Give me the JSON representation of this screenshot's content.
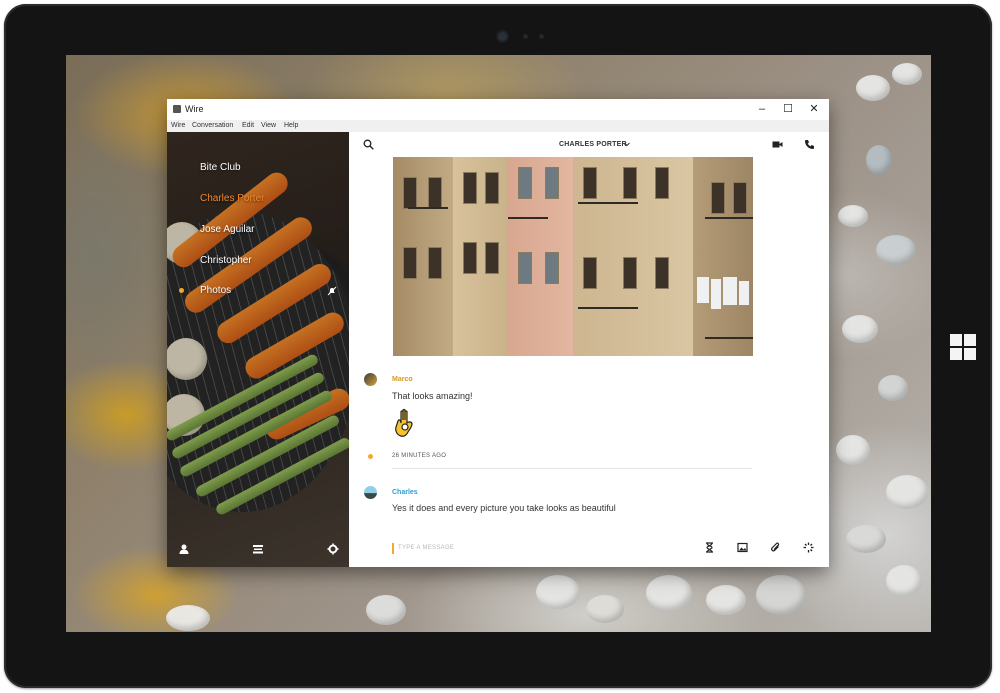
{
  "window": {
    "title": "Wire",
    "minimize": "–",
    "maximize": "☐",
    "close": "✕"
  },
  "menu": [
    "Wire",
    "Conversation",
    "Edit",
    "View",
    "Help"
  ],
  "sidebar": {
    "conversations": [
      {
        "name": "Bite Club",
        "active": false,
        "unread": false,
        "muted": false
      },
      {
        "name": "Charles Porter",
        "active": true,
        "unread": false,
        "muted": false
      },
      {
        "name": "Jose Aguilar",
        "active": false,
        "unread": false,
        "muted": false
      },
      {
        "name": "Christopher",
        "active": false,
        "unread": false,
        "muted": false
      },
      {
        "name": "Photos",
        "active": false,
        "unread": true,
        "muted": true
      }
    ],
    "footer_icons": [
      "profile-icon",
      "archive-icon",
      "settings-icon"
    ]
  },
  "conversation": {
    "title": "CHARLES PORTER",
    "header_icons": [
      "search-icon",
      "video-call-icon",
      "phone-icon"
    ]
  },
  "messages": [
    {
      "author": "Marco",
      "author_color": "#d89b12",
      "text": "That looks amazing!",
      "emoji": "ok-hand-emoji"
    },
    {
      "system": "26 MINUTES AGO"
    },
    {
      "author": "Charles",
      "author_color": "#2a9fd0",
      "text": "Yes it does and every picture you take looks as beautiful"
    }
  ],
  "composer": {
    "placeholder": "TYPE A MESSAGE",
    "icons": [
      "timer-icon",
      "image-icon",
      "attach-icon",
      "ping-icon"
    ]
  },
  "colors": {
    "accent": "#f3882b",
    "unread": "#f3a92b"
  }
}
